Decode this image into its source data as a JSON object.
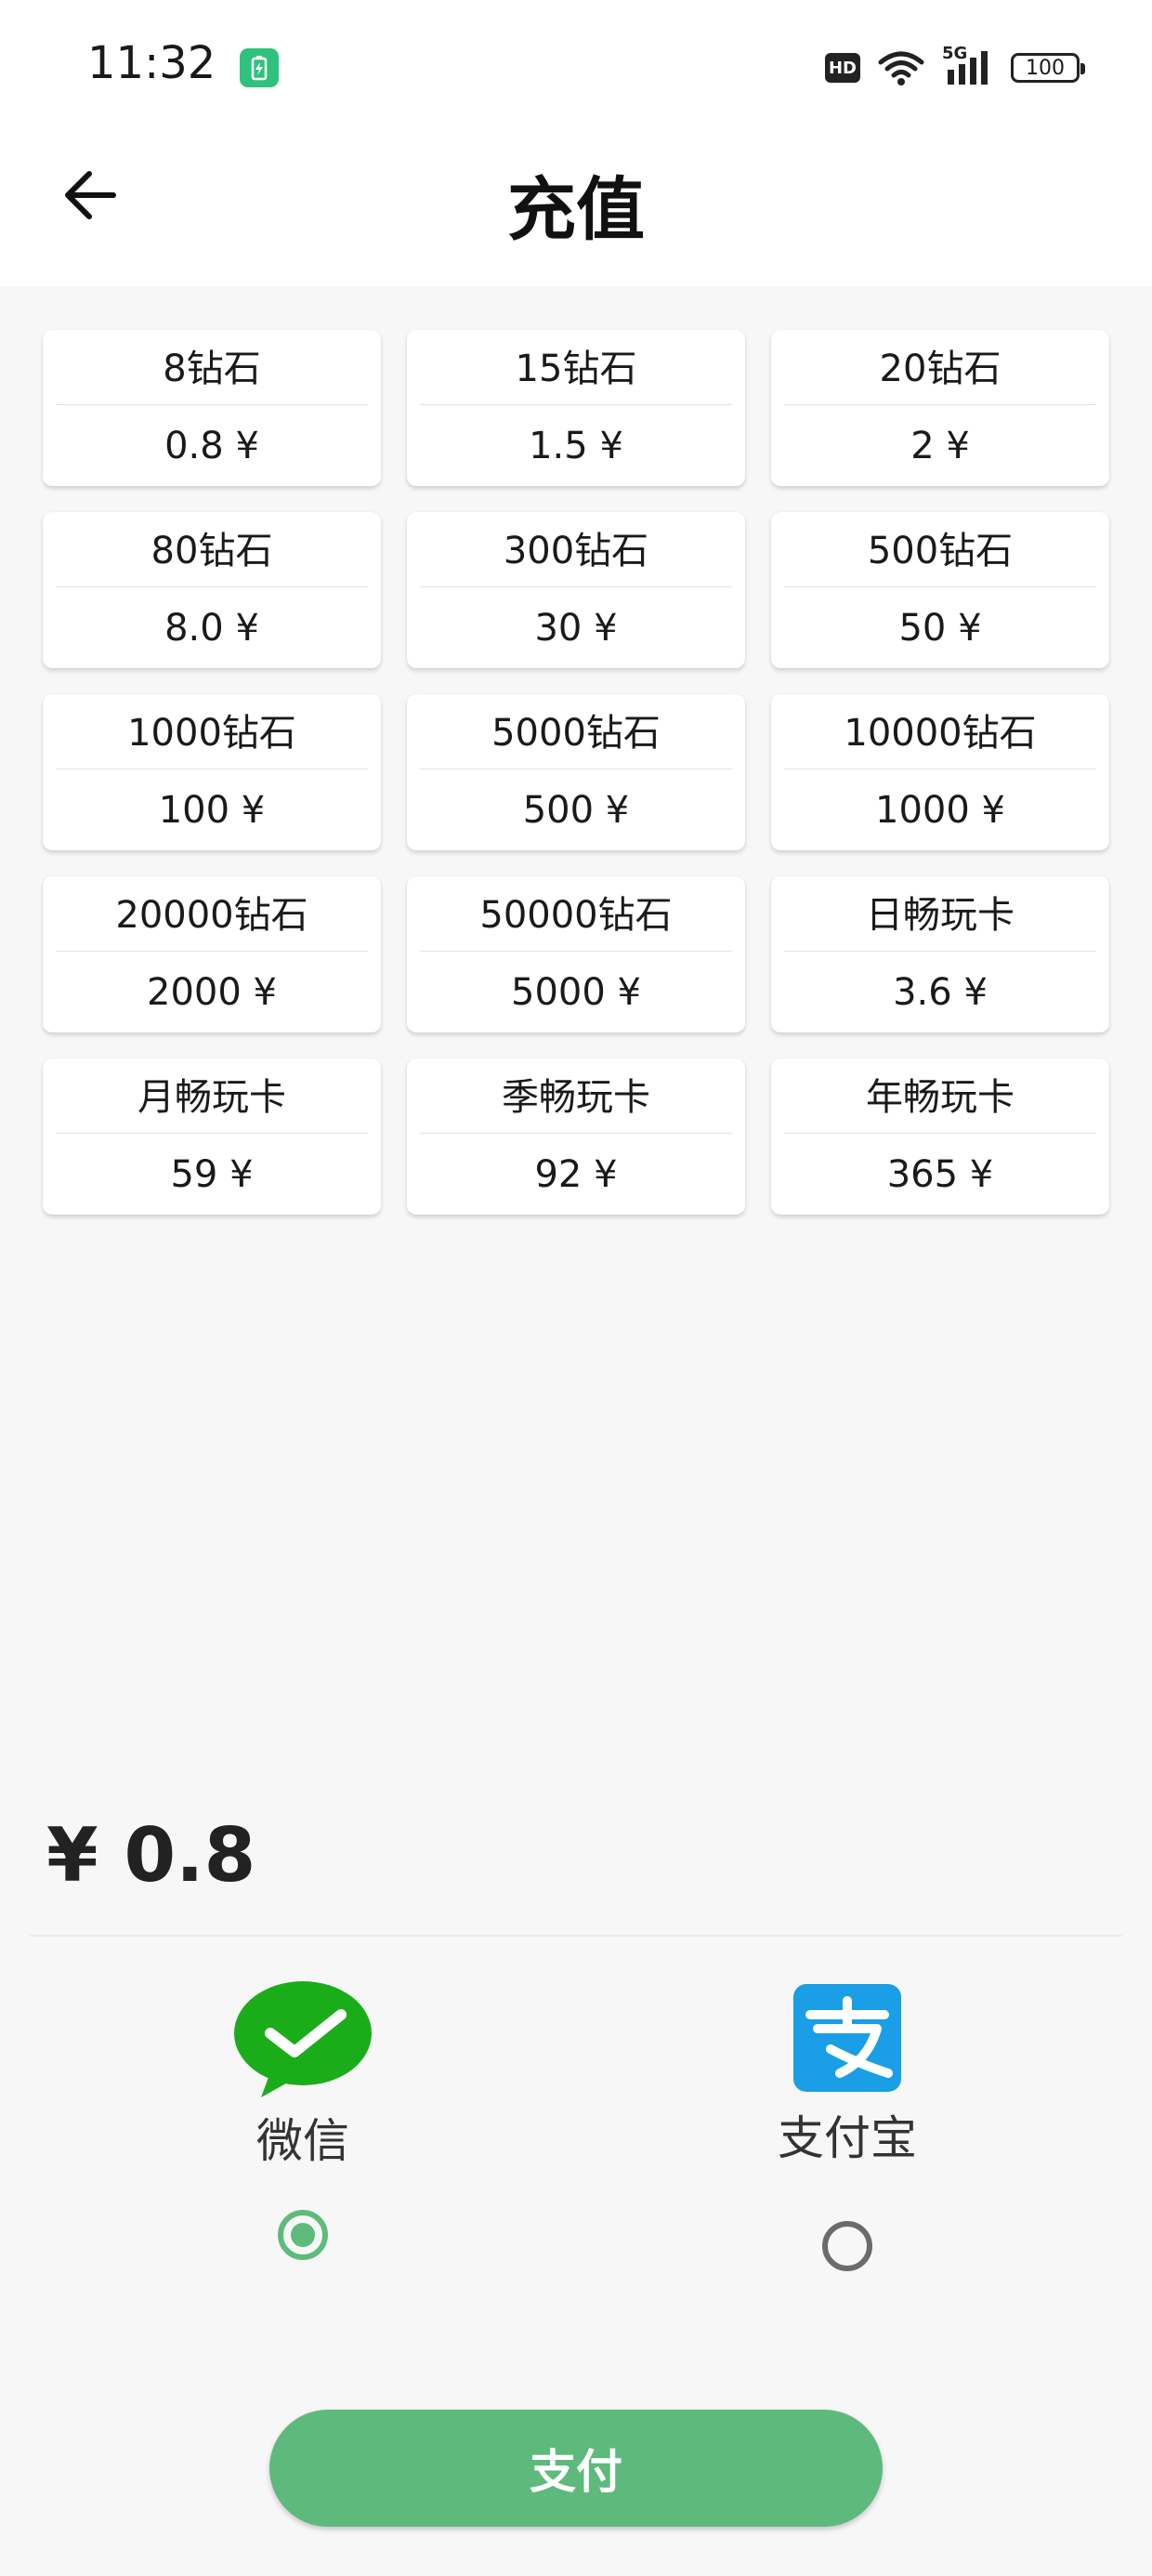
{
  "status_bar": {
    "time": "11:32",
    "app_icon": "battery-charging-icon",
    "hd_label": "HD",
    "network_label": "5G",
    "battery_level": "100"
  },
  "header": {
    "title": "充值",
    "back_icon": "arrow-left-icon"
  },
  "packages": [
    {
      "name": "8钻石",
      "price": "0.8 ¥"
    },
    {
      "name": "15钻石",
      "price": "1.5 ¥"
    },
    {
      "name": "20钻石",
      "price": "2 ¥"
    },
    {
      "name": "80钻石",
      "price": "8.0 ¥"
    },
    {
      "name": "300钻石",
      "price": "30 ¥"
    },
    {
      "name": "500钻石",
      "price": "50 ¥"
    },
    {
      "name": "1000钻石",
      "price": "100 ¥"
    },
    {
      "name": "5000钻石",
      "price": "500 ¥"
    },
    {
      "name": "10000钻石",
      "price": "1000 ¥"
    },
    {
      "name": "20000钻石",
      "price": "2000 ¥"
    },
    {
      "name": "50000钻石",
      "price": "5000 ¥"
    },
    {
      "name": "日畅玩卡",
      "price": "3.6 ¥"
    },
    {
      "name": "月畅玩卡",
      "price": "59 ¥"
    },
    {
      "name": "季畅玩卡",
      "price": "92 ¥"
    },
    {
      "name": "年畅玩卡",
      "price": "365 ¥"
    }
  ],
  "total": "¥ 0.8",
  "payment": {
    "wechat": {
      "label": "微信",
      "icon": "wechat-icon",
      "selected": true
    },
    "alipay": {
      "label": "支付宝",
      "icon": "alipay-icon",
      "selected": false
    }
  },
  "pay_button": "支付",
  "colors": {
    "accent": "#5dba7c",
    "wechat": "#1aad19",
    "alipay": "#1a9ee6"
  }
}
